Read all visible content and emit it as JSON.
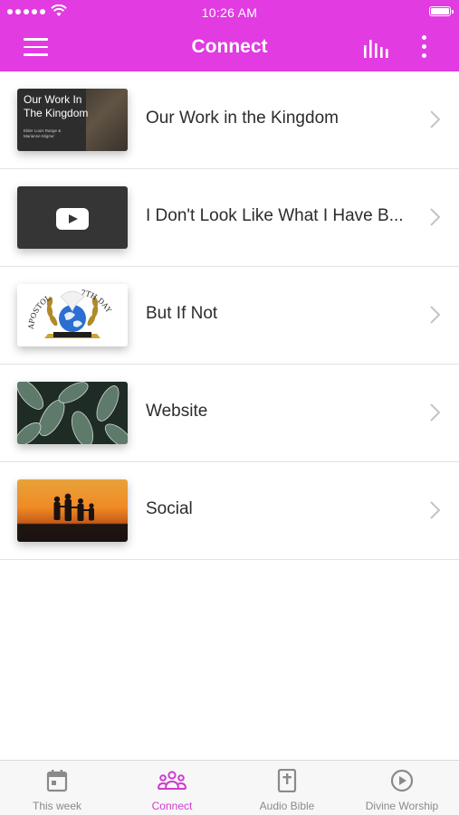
{
  "status_bar": {
    "time": "10:26 AM"
  },
  "header": {
    "title": "Connect"
  },
  "list": [
    {
      "label": "Our Work in the Kingdom",
      "thumbnail_title": "Our Work In\nThe Kingdom",
      "thumbnail_caption": "Elder Louis Range &\nMarianne Migme´"
    },
    {
      "label": "I Don't Look Like What I Have B..."
    },
    {
      "label": "But If Not",
      "logo_text_left": "APOSTOL",
      "logo_text_right": "7TH DAY"
    },
    {
      "label": "Website"
    },
    {
      "label": "Social"
    }
  ],
  "tabs": [
    {
      "label": "This week",
      "icon": "calendar-icon",
      "active": false
    },
    {
      "label": "Connect",
      "icon": "people-icon",
      "active": true
    },
    {
      "label": "Audio Bible",
      "icon": "bible-icon",
      "active": false
    },
    {
      "label": "Divine Worship",
      "icon": "play-circle-icon",
      "active": false
    }
  ],
  "colors": {
    "header": "#e13be1",
    "active_tab": "#d03bd0",
    "inactive_tab": "#8a8a8a"
  }
}
